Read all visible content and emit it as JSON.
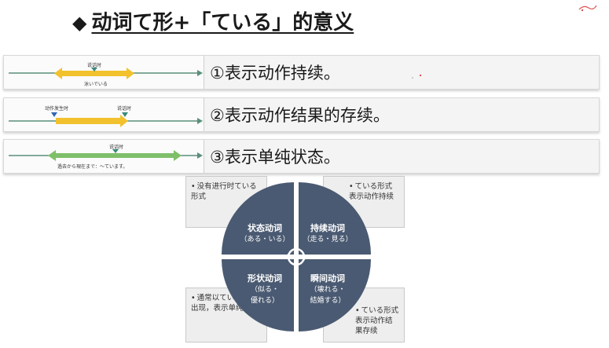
{
  "title": {
    "symbol": "◆",
    "text": "动词て形+「ている」的意义"
  },
  "rows": [
    {
      "label": "①表示动作持续。",
      "diagram": {
        "top_label": "说话时",
        "bottom_label": "泳いでいる"
      }
    },
    {
      "label": "②表示动作结果的存续。",
      "diagram": {
        "left_label": "动作发生时",
        "right_label": "说话时"
      }
    },
    {
      "label": "③表示单纯状态。",
      "diagram": {
        "top_label": "说话时",
        "bottom_label": "過去から現在まで：～ています。"
      }
    }
  ],
  "cards": {
    "top_left": "没有进行时ている形式",
    "top_right": "ている形式表示动作持续",
    "bottom_left": "通常以ている形式出现，表示单纯状态",
    "bottom_right": "ている形式表示动作结果存续"
  },
  "quadrants": {
    "top_left": {
      "title": "状态动词",
      "sub": "（ある・いる）"
    },
    "top_right": {
      "title": "持续动词",
      "sub": "（走る・見る）"
    },
    "bottom_left": {
      "title": "形状动词",
      "sub": "（似る・",
      "sub2": "優れる）"
    },
    "bottom_right": {
      "title": "瞬间动词",
      "sub": "（壊れる・",
      "sub2": "結婚する）"
    }
  },
  "colors": {
    "quadrant": "#4a5a72",
    "arrow_yellow": "#f2c12e",
    "arrow_green": "#7fbf6a",
    "axis": "#5b8f7a",
    "marker_teal": "#3b8a7a",
    "marker_blue": "#2f66b3"
  }
}
